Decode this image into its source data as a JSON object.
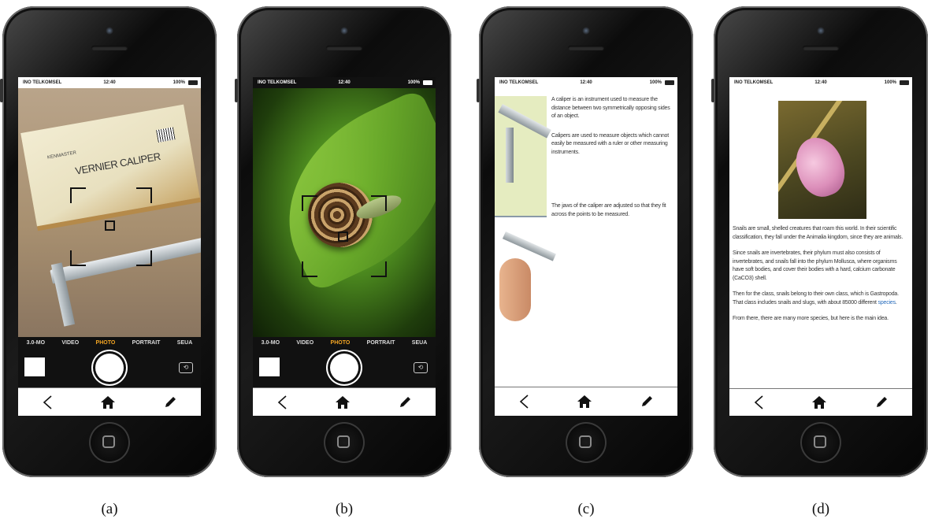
{
  "status": {
    "carrier": "INO TELKOMSEL",
    "time": "12:40",
    "battery": "100%"
  },
  "camera": {
    "modes": [
      "3.0-MO",
      "VIDEO",
      "PHOTO",
      "PORTRAIT",
      "SEUA"
    ],
    "active_mode": "PHOTO"
  },
  "panel_a": {
    "box_brand": "KENMASTER",
    "box_title": "VERNIER CALIPER"
  },
  "panel_c": {
    "para1": "A caliper is an instrument used to measure the distance between two symmetrically opposing sides of an object.",
    "para2": "Calipers are used to measure objects which cannot easily be measured with a ruler or other measuring instruments.",
    "para3": "The jaws of the caliper are adjusted so that they fit across the points to be measured."
  },
  "panel_d": {
    "para1": "Snails are small, shelled creatures that roam this world. In their scientific classification, they fall under the Animalia kingdom, since they are animals.",
    "para2": "Since snails are invertebrates, their phylum must also consists of invertebrates, and snails fall into the phylum Mollusca, where organisms have soft bodies, and cover their bodies with a hard, calcium carbonate (CaCO3) shell.",
    "para3_before_link": "Then for the class, snails belong to their own class, which is Gastropoda. That class includes snails and slugs, with about 85000 different ",
    "para3_link": "species",
    "para3_after_link": ".",
    "para4": "From there, there are many more species, but here is the main idea."
  },
  "nav": {
    "back_icon": "chevron-left-icon",
    "home_icon": "home-icon",
    "edit_icon": "pencil-icon"
  },
  "captions": [
    "(a)",
    "(b)",
    "(c)",
    "(d)"
  ],
  "colors": {
    "active_mode": "#f5a623",
    "link": "#2a6ebd",
    "leaf": "#5a9a2a"
  }
}
